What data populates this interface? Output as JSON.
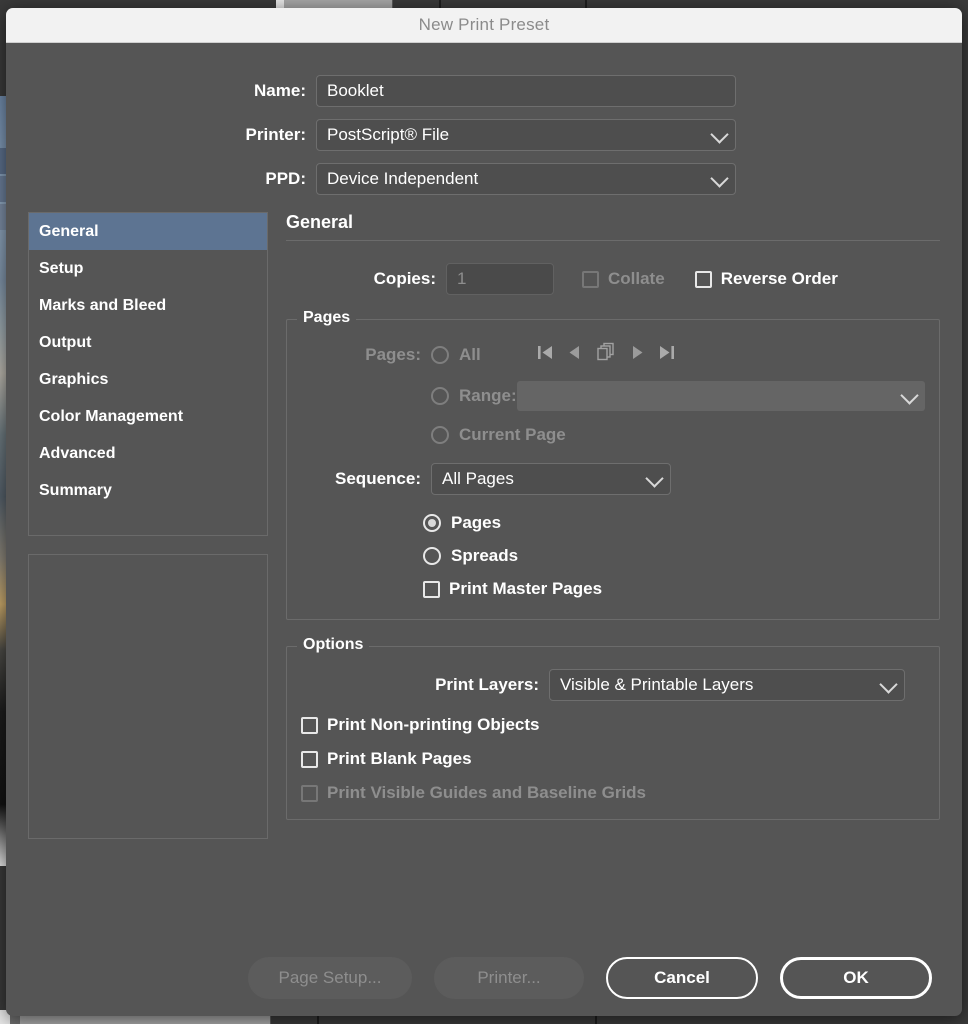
{
  "window": {
    "title": "New Print Preset"
  },
  "top_fields": {
    "name": {
      "label": "Name:",
      "value": "Booklet"
    },
    "printer": {
      "label": "Printer:",
      "value": "PostScript® File"
    },
    "ppd": {
      "label": "PPD:",
      "value": "Device Independent"
    }
  },
  "sidebar": {
    "items": [
      {
        "label": "General",
        "selected": true
      },
      {
        "label": "Setup",
        "selected": false
      },
      {
        "label": "Marks and Bleed",
        "selected": false
      },
      {
        "label": "Output",
        "selected": false
      },
      {
        "label": "Graphics",
        "selected": false
      },
      {
        "label": "Color Management",
        "selected": false
      },
      {
        "label": "Advanced",
        "selected": false
      },
      {
        "label": "Summary",
        "selected": false
      }
    ],
    "selected_color": "#5d7492"
  },
  "pane": {
    "heading": "General",
    "copies": {
      "label": "Copies:",
      "value": "1",
      "collate_label": "Collate",
      "reverse_order_label": "Reverse Order"
    },
    "pages_group": {
      "legend": "Pages",
      "pages_label": "Pages:",
      "all_label": "All",
      "range_label": "Range:",
      "range_value": "",
      "current_page_label": "Current Page",
      "nav_icons": [
        "first-page-icon",
        "previous-page-icon",
        "pages-stack-icon",
        "next-page-icon",
        "last-page-icon"
      ],
      "sequence_label": "Sequence:",
      "sequence_value": "All Pages",
      "pages_radio_label": "Pages",
      "spreads_radio_label": "Spreads",
      "print_master_pages_label": "Print Master Pages"
    },
    "options_group": {
      "legend": "Options",
      "print_layers_label": "Print Layers:",
      "print_layers_value": "Visible & Printable Layers",
      "print_non_printing_label": "Print Non-printing Objects",
      "print_blank_pages_label": "Print Blank Pages",
      "print_guides_label": "Print Visible Guides and Baseline Grids"
    }
  },
  "footer": {
    "page_setup_label": "Page Setup...",
    "printer_label": "Printer...",
    "cancel_label": "Cancel",
    "ok_label": "OK"
  },
  "colors": {
    "dialog_bg": "#555555",
    "titlebar_bg": "#f2f2f2",
    "accent": "#5d7492",
    "field_bg": "#4e4e4e",
    "disabled_text": "#8e8e8e"
  }
}
